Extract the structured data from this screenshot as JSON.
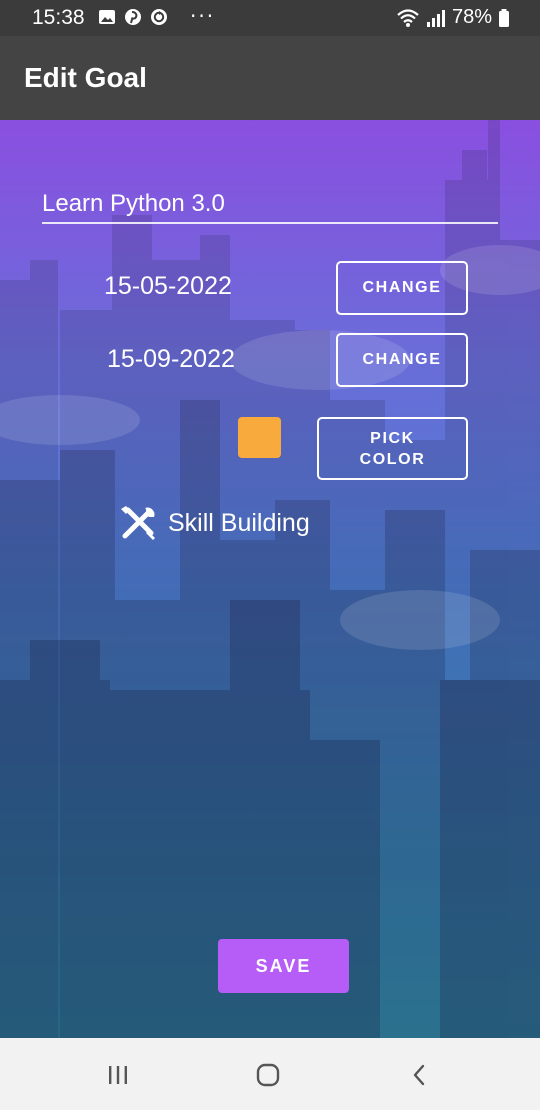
{
  "status_bar": {
    "time": "15:38",
    "battery": "78%",
    "icons_left": [
      "gallery-icon",
      "pinterest-icon",
      "sync-icon",
      "more-icon"
    ],
    "icons_right": [
      "wifi-icon",
      "signal-icon",
      "battery-icon"
    ]
  },
  "app_bar": {
    "title": "Edit Goal"
  },
  "form": {
    "goal_title": "Learn Python 3.0",
    "start_date": "15-05-2022",
    "end_date": "15-09-2022",
    "change_start_label": "CHANGE",
    "change_end_label": "CHANGE",
    "pick_color_line1": "PICK",
    "pick_color_line2": "COLOR",
    "selected_color": "#f9aa3c",
    "category_icon": "tools-icon",
    "category_label": "Skill Building",
    "save_label": "SAVE",
    "save_color": "#b65cf7"
  },
  "nav_bar": {
    "items": [
      "recent-apps-icon",
      "home-icon",
      "back-icon"
    ]
  }
}
